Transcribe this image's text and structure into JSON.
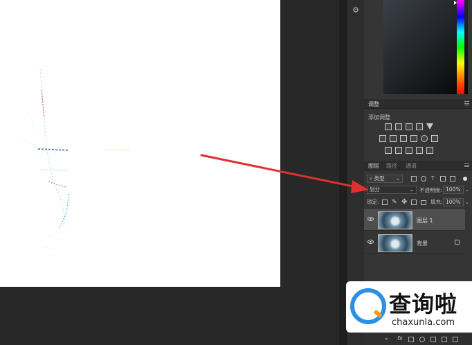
{
  "adjustments_panel": {
    "tab_label": "调整",
    "add_adjustment_label": "添加调整"
  },
  "layers_panel": {
    "tabs": [
      {
        "label": "图层",
        "active": true
      },
      {
        "label": "路径",
        "active": false
      },
      {
        "label": "通道",
        "active": false
      }
    ],
    "filter_kind": "类型",
    "blend_mode": "划分",
    "opacity_label": "不透明度:",
    "opacity_value": "100%",
    "lock_label": "锁定:",
    "fill_label": "填充:",
    "fill_value": "100%",
    "layers": [
      {
        "name": "图层 1",
        "selected": true,
        "locked": false
      },
      {
        "name": "背景",
        "selected": false,
        "locked": true
      }
    ],
    "footer_fx": "fx"
  },
  "watermark": {
    "brand_cn": "查询啦",
    "brand_url": "chaxunla.com"
  },
  "colors": {
    "annotation_arrow": "#e03030",
    "panel_bg": "#353535",
    "workspace_bg": "#282828",
    "selected_layer_bg": "#4e4e4e"
  }
}
